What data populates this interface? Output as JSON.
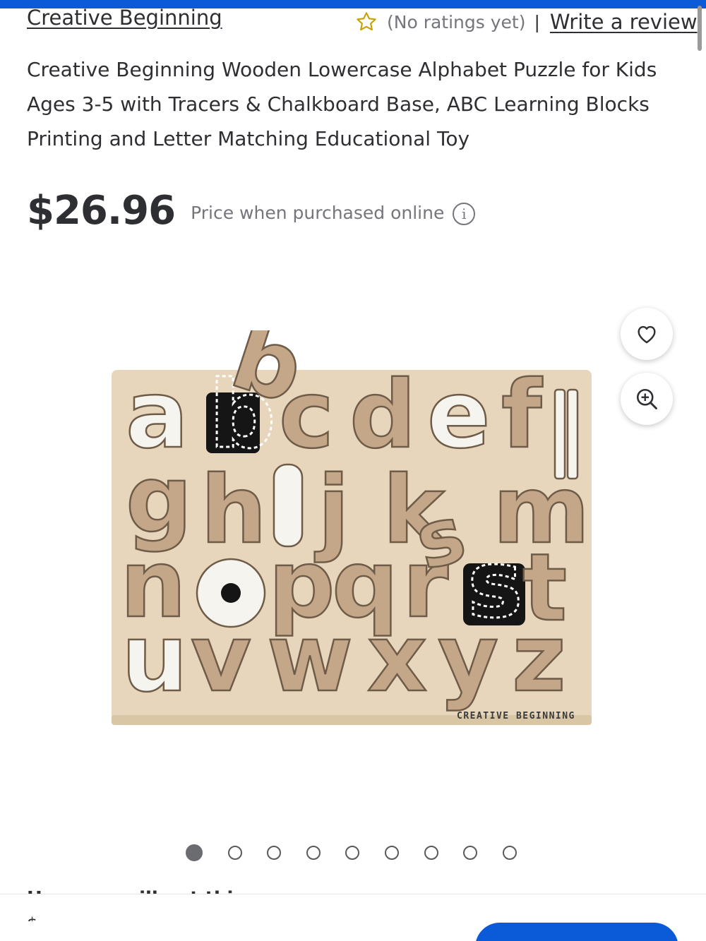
{
  "colors": {
    "accent": "#0b5bd8",
    "star": "#c8a100",
    "text": "#2e2f32",
    "muted": "#74767c"
  },
  "header": {
    "brand": "Creative Beginning",
    "rating_text": "(No ratings yet)",
    "separator": "|",
    "review_link": "Write a review"
  },
  "product": {
    "title": "Creative Beginning Wooden Lowercase Alphabet Puzzle for Kids Ages 3-5 with Tracers & Chalkboard Base, ABC Learning Blocks Printing and Letter Matching Educational Toy",
    "price": "$26.96",
    "price_note": "Price when purchased online",
    "image_watermark": "CREATIVE BEGINNING"
  },
  "icons": {
    "rating": "star-outline-icon",
    "favorite": "heart-icon",
    "zoom": "zoom-in-icon",
    "info": "info-icon"
  },
  "carousel": {
    "total": 9,
    "active": 1
  },
  "below_fold": {
    "heading": "How you will get this item",
    "bottom_label": "$"
  }
}
